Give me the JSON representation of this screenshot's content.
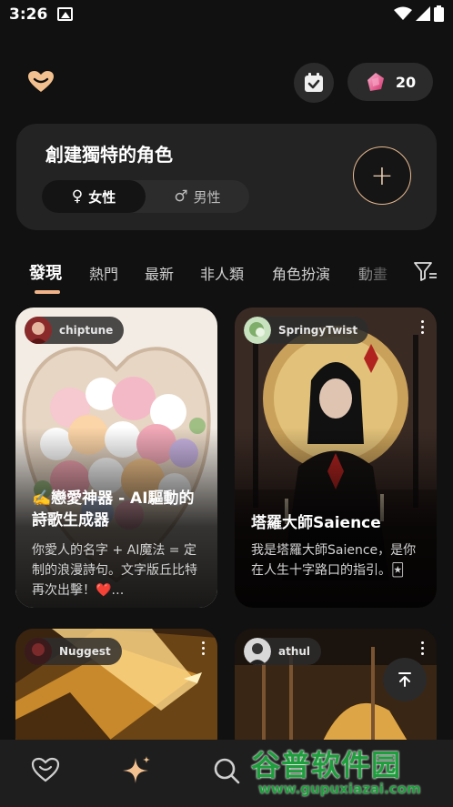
{
  "status": {
    "time": "3:26"
  },
  "header": {
    "gem_count": "20"
  },
  "create": {
    "title": "創建獨特的角色",
    "female_label": "女性",
    "male_label": "男性"
  },
  "tabs": [
    {
      "label": "發現"
    },
    {
      "label": "熱門"
    },
    {
      "label": "最新"
    },
    {
      "label": "非人類"
    },
    {
      "label": "角色扮演"
    },
    {
      "label": "動畫"
    }
  ],
  "cards": [
    {
      "author": "chiptune",
      "title": "✍️戀愛神器 - AI驅動的詩歌生成器",
      "description": "你愛人的名字 + AI魔法 = 定制的浪漫詩句。文字版丘比特再次出擊！❤️…"
    },
    {
      "author": "SpringyTwist",
      "title": "塔羅大師Saience",
      "description": "我是塔羅大師Saience，是你在人生十字路口的指引。🃏"
    },
    {
      "author": "Nuggest",
      "title": "",
      "description": ""
    },
    {
      "author": "athul",
      "title": "",
      "description": ""
    }
  ],
  "watermark": {
    "cn": "谷普软件园",
    "en": "www.gupuxiazai.com"
  },
  "colors": {
    "accent": "#f1b489",
    "background": "#111111",
    "card": "#232323"
  },
  "icons": {
    "logo": "heart-face-icon",
    "calendar": "calendar-check-icon",
    "gem": "gem-icon",
    "filter": "filter-icon",
    "to_top": "arrow-to-top-icon",
    "nav": [
      "heart-face-icon",
      "sparkle-icon",
      "search-icon"
    ]
  }
}
